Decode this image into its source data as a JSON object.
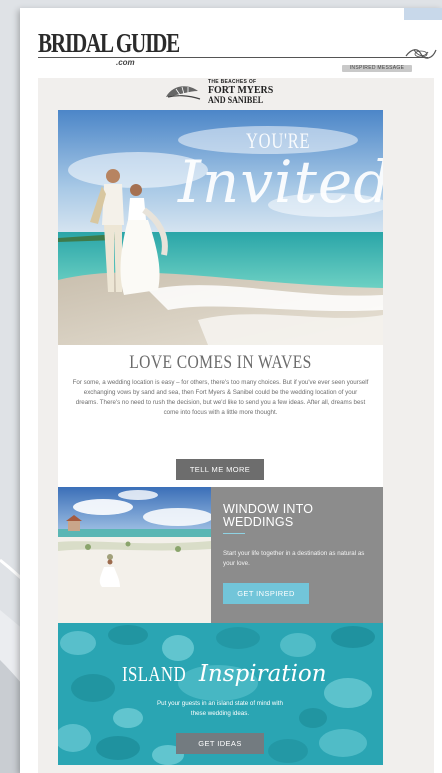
{
  "header": {
    "brand_name": "BRIDAL GUIDE",
    "brand_sub": ".com",
    "pill_label": "INSPIRED MESSAGE"
  },
  "sponsor": {
    "line1": "THE BEACHES OF",
    "line2": "FORT MYERS",
    "line3": "AND SANIBEL"
  },
  "hero": {
    "line1": "YOU'RE",
    "line2": "Invited"
  },
  "intro": {
    "title": "LOVE COMES IN WAVES",
    "body": "For some, a wedding location is easy – for others, there's too many choices. But if you've ever seen yourself exchanging vows by sand and sea, then Fort Myers & Sanibel could be the wedding location of your dreams. There's no need to rush the decision, but we'd like to send you a few ideas. After all, dreams best come into focus with a little more thought.",
    "button": "TELL ME MORE"
  },
  "window": {
    "title_line1": "WINDOW INTO",
    "title_line2": "WEDDINGS",
    "body": "Start your life together in a destination as natural as your love.",
    "button": "GET INSPIRED"
  },
  "island": {
    "title_main": "ISLAND",
    "title_script": "Inspiration",
    "body": "Put your guests in an island state of mind with these wedding ideas.",
    "button": "GET IDEAS"
  },
  "colors": {
    "accent_blue": "#72c5d9",
    "panel_gray": "#8c8c8c",
    "button_dark": "#6d6d6d",
    "turquoise": "#2aa5b3"
  }
}
